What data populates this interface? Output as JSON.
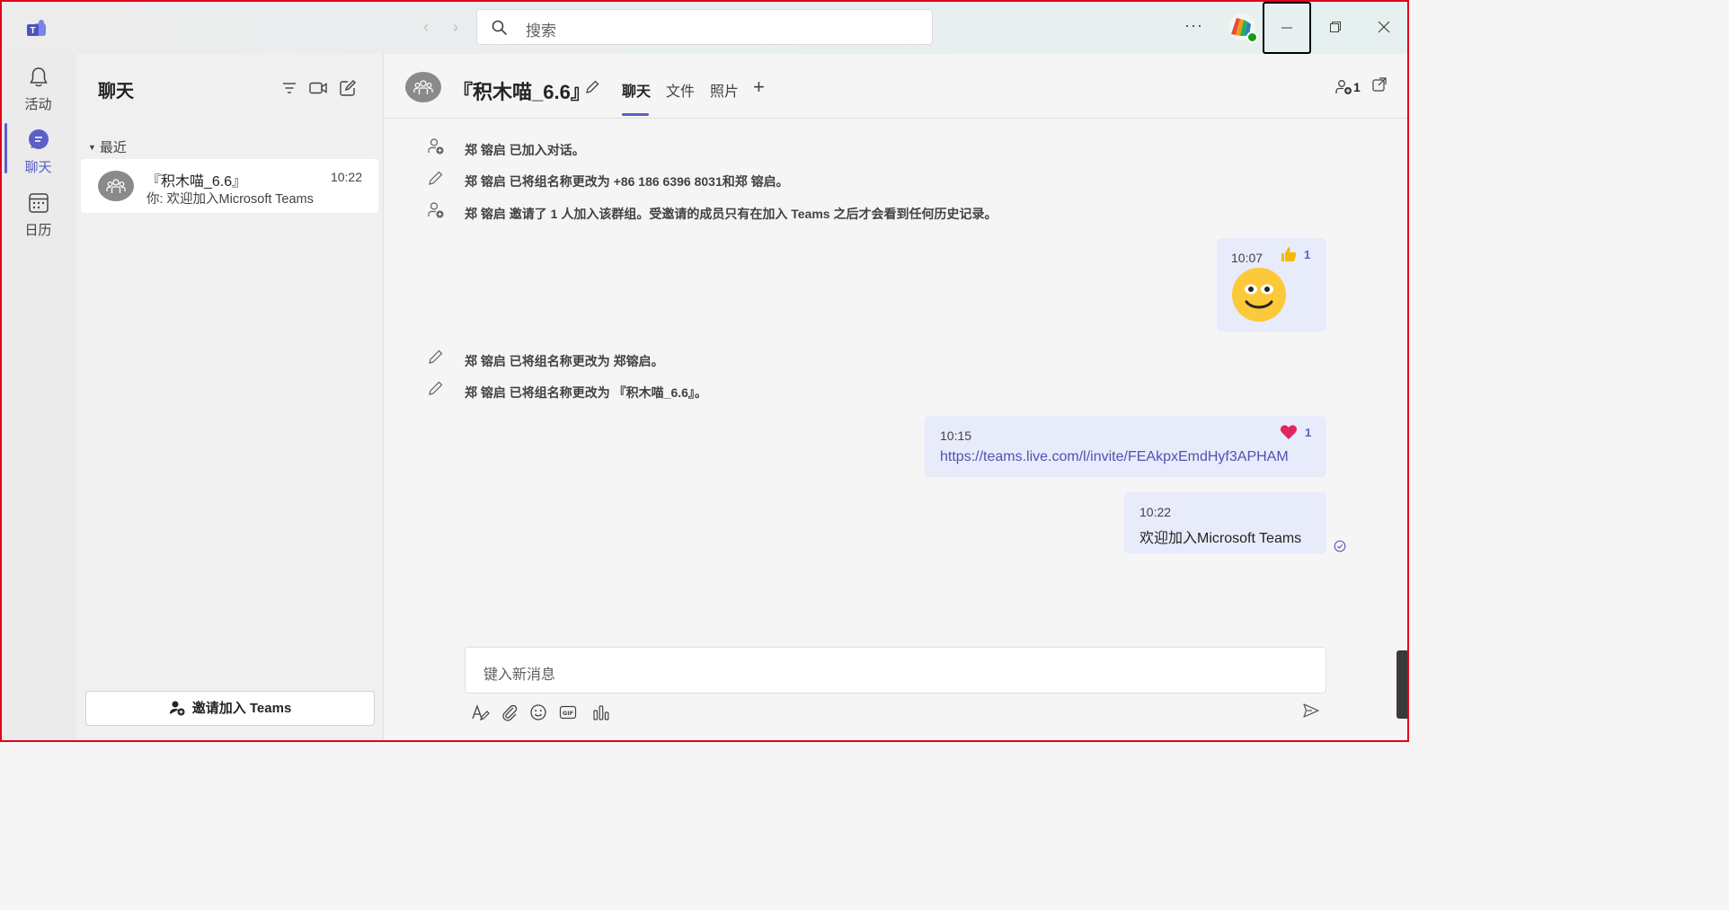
{
  "titlebar": {
    "search_placeholder": "搜索"
  },
  "rail": {
    "items": [
      {
        "label": "活动",
        "icon": "bell-icon"
      },
      {
        "label": "聊天",
        "icon": "chat-icon",
        "active": true
      },
      {
        "label": "日历",
        "icon": "calendar-icon"
      }
    ]
  },
  "chatlist": {
    "title": "聊天",
    "section": "最近",
    "items": [
      {
        "name": "『积木喵_6.6』",
        "time": "10:22",
        "preview": "你: 欢迎加入Microsoft Teams"
      }
    ],
    "invite_button": "邀请加入 Teams"
  },
  "conversation": {
    "title": "『积木喵_6.6』",
    "tabs": [
      "聊天",
      "文件",
      "照片"
    ],
    "participant_count": "1",
    "system_messages": [
      {
        "icon": "person-add-icon",
        "text": "郑 镕启 已加入对话。"
      },
      {
        "icon": "pencil-icon",
        "text": "郑 镕启 已将组名称更改为 +86 186 6396 8031和郑 镕启。"
      },
      {
        "icon": "person-add-icon",
        "text": "郑 镕启 邀请了 1 人加入该群组。受邀请的成员只有在加入 Teams 之后才会看到任何历史记录。"
      },
      {
        "icon": "pencil-icon",
        "text": "郑 镕启 已将组名称更改为 郑镕启。"
      },
      {
        "icon": "pencil-icon",
        "text": "郑 镕启 已将组名称更改为 『积木喵_6.6』。"
      }
    ],
    "messages": [
      {
        "time": "10:07",
        "content_type": "emoji",
        "content": "smiley-face",
        "reaction": "thumbs-up",
        "reaction_count": "1"
      },
      {
        "time": "10:15",
        "content_type": "link",
        "content": "https://teams.live.com/l/invite/FEAkpxEmdHyf3APHAM",
        "reaction": "heart",
        "reaction_count": "1"
      },
      {
        "time": "10:22",
        "content_type": "text",
        "content": "欢迎加入Microsoft Teams",
        "status": "sent"
      }
    ],
    "composer_placeholder": "键入新消息"
  },
  "colors": {
    "accent": "#5b5fc7",
    "bubble": "#e8ebfa",
    "heart": "#e0245e",
    "thumbs": "#f5b800"
  }
}
